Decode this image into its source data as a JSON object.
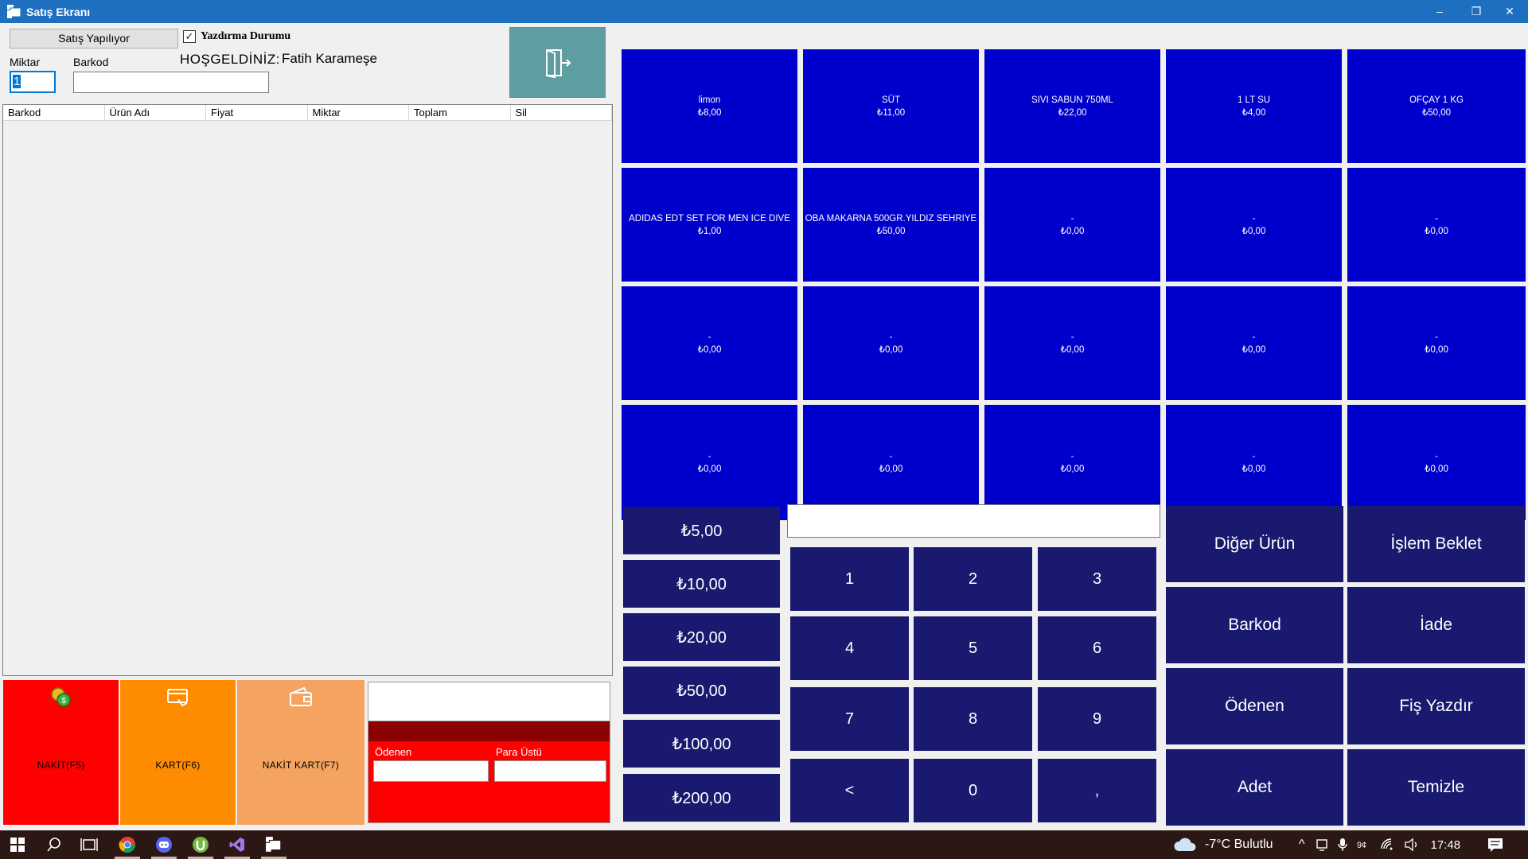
{
  "window": {
    "title": "Satış Ekranı",
    "minimize": "–",
    "restore": "❐",
    "close": "✕"
  },
  "header": {
    "status_button": "Satış Yapılıyor",
    "print_status_label": "Yazdırma Durumu",
    "print_checked_mark": "✓",
    "qty_label": "Miktar",
    "barcode_label": "Barkod",
    "qty_value": "1",
    "barcode_value": "",
    "welcome_label": "HOŞGELDİNİZ:",
    "user_name": "Fatih Karameşe"
  },
  "grid": {
    "columns": [
      "Barkod",
      "Ürün Adı",
      "Fiyat",
      "Miktar",
      "Toplam",
      "Sil"
    ]
  },
  "payments": {
    "cash": "NAKİT(F5)",
    "card": "KART(F6)",
    "cash_card": "NAKİT KART(F7)"
  },
  "totals": {
    "paid_label": "Ödenen",
    "change_label": "Para Üstü"
  },
  "products": [
    {
      "name": "limon",
      "price": "₺8,00"
    },
    {
      "name": "SÜT",
      "price": "₺11,00"
    },
    {
      "name": "SIVI SABUN 750ML",
      "price": "₺22,00"
    },
    {
      "name": "1 LT SU",
      "price": "₺4,00"
    },
    {
      "name": "OFÇAY 1 KG",
      "price": "₺50,00"
    },
    {
      "name": "ADIDAS EDT SET FOR MEN ICE DIVE",
      "price": "₺1,00"
    },
    {
      "name": "OBA MAKARNA 500GR.YILDIZ SEHRIYE",
      "price": "₺50,00"
    },
    {
      "name": "-",
      "price": "₺0,00"
    },
    {
      "name": "-",
      "price": "₺0,00"
    },
    {
      "name": "-",
      "price": "₺0,00"
    },
    {
      "name": "-",
      "price": "₺0,00"
    },
    {
      "name": "-",
      "price": "₺0,00"
    },
    {
      "name": "-",
      "price": "₺0,00"
    },
    {
      "name": "-",
      "price": "₺0,00"
    },
    {
      "name": "-",
      "price": "₺0,00"
    },
    {
      "name": "-",
      "price": "₺0,00"
    },
    {
      "name": "-",
      "price": "₺0,00"
    },
    {
      "name": "-",
      "price": "₺0,00"
    },
    {
      "name": "-",
      "price": "₺0,00"
    },
    {
      "name": "-",
      "price": "₺0,00"
    }
  ],
  "money_buttons": [
    "₺5,00",
    "₺10,00",
    "₺20,00",
    "₺50,00",
    "₺100,00",
    "₺200,00"
  ],
  "numpad": [
    "1",
    "2",
    "3",
    "4",
    "5",
    "6",
    "7",
    "8",
    "9",
    "<",
    "0",
    ","
  ],
  "actions": [
    "Diğer Ürün",
    "İşlem Beklet",
    "Barkod",
    "İade",
    "Ödenen",
    "Fiş Yazdır",
    "Adet",
    "Temizle"
  ],
  "taskbar": {
    "weather": "-7°C Bulutlu",
    "time": "17:48"
  },
  "colors": {
    "title_bar": "#1f6fc1",
    "product_tile": "#0000cd",
    "keypad": "#191970",
    "cash": "#ff0000",
    "card": "#ff8c00",
    "cash_card": "#f4a460",
    "exit_button": "#5f9ea0",
    "totals_band": "#8b0000"
  }
}
